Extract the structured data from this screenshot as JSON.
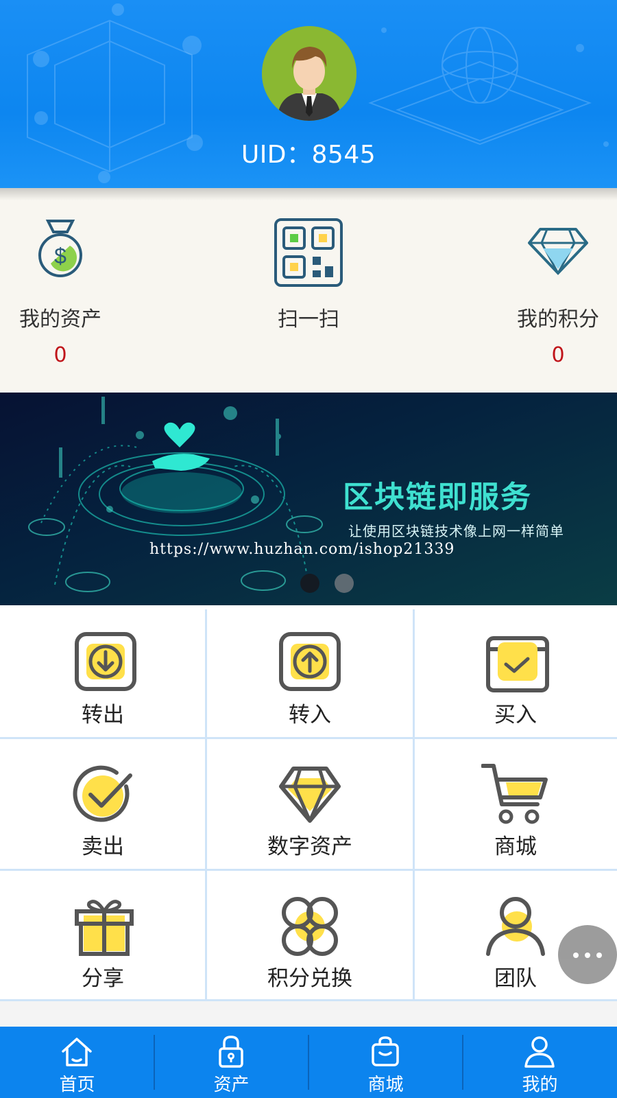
{
  "header": {
    "uid_text": "UID：8545"
  },
  "stats": {
    "assets": {
      "label": "我的资产",
      "value": "0"
    },
    "scan": {
      "label": "扫一扫"
    },
    "points": {
      "label": "我的积分",
      "value": "0"
    }
  },
  "banner": {
    "title": "区块链即服务",
    "subtitle": "让使用区块链技术像上网一样简单",
    "watermark": "https://www.huzhan.com/ishop21339",
    "active_slide": 1,
    "slide_count": 2
  },
  "grid": {
    "items": [
      {
        "label": "转出",
        "icon": "transfer-out-icon"
      },
      {
        "label": "转入",
        "icon": "transfer-in-icon"
      },
      {
        "label": "买入",
        "icon": "buy-icon"
      },
      {
        "label": "卖出",
        "icon": "sell-icon"
      },
      {
        "label": "数字资产",
        "icon": "diamond-icon"
      },
      {
        "label": "商城",
        "icon": "cart-icon"
      },
      {
        "label": "分享",
        "icon": "gift-icon"
      },
      {
        "label": "积分兑换",
        "icon": "clover-icon"
      },
      {
        "label": "团队",
        "icon": "user-icon"
      }
    ]
  },
  "nav": {
    "items": [
      {
        "label": "首页",
        "icon": "home-icon"
      },
      {
        "label": "资产",
        "icon": "lock-icon"
      },
      {
        "label": "商城",
        "icon": "bag-icon"
      },
      {
        "label": "我的",
        "icon": "user-icon"
      }
    ]
  },
  "colors": {
    "primary_blue": "#0c84ee",
    "accent_yellow": "#ffe04a",
    "icon_gray": "#555555",
    "value_red": "#c0141a",
    "banner_teal": "#3fe0d0"
  }
}
